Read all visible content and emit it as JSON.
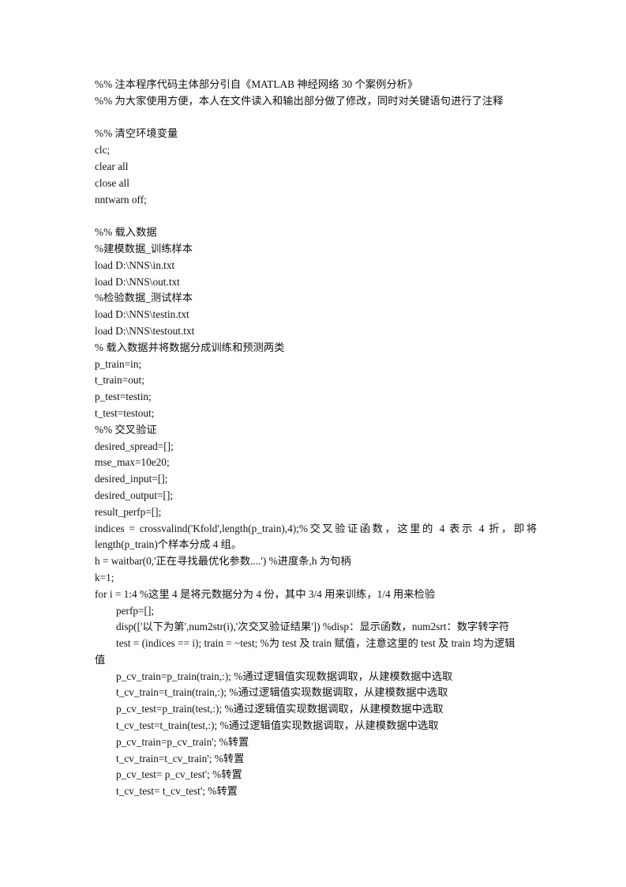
{
  "document": {
    "lines": [
      {
        "text": "%%  注本程序代码主体部分引自《MATLAB 神经网络 30 个案例分析》"
      },
      {
        "text": "%%  为大家使用方便，本人在文件读入和输出部分做了修改，同时对关键语句进行了注释"
      },
      {
        "text": ""
      },
      {
        "text": "%%  清空环境变量"
      },
      {
        "text": "clc;"
      },
      {
        "text": "clear all"
      },
      {
        "text": "close all"
      },
      {
        "text": "nntwarn off;"
      },
      {
        "text": ""
      },
      {
        "text": "%%  载入数据"
      },
      {
        "text": "%建模数据_训练样本"
      },
      {
        "text": "load D:\\NNS\\in.txt"
      },
      {
        "text": "load D:\\NNS\\out.txt"
      },
      {
        "text": "%检验数据_测试样本"
      },
      {
        "text": "load D:\\NNS\\testin.txt"
      },
      {
        "text": "load D:\\NNS\\testout.txt"
      },
      {
        "text": "%  载入数据并将数据分成训练和预测两类"
      },
      {
        "text": "p_train=in;"
      },
      {
        "text": "t_train=out;"
      },
      {
        "text": "p_test=testin;"
      },
      {
        "text": "t_test=testout;"
      },
      {
        "text": "%%  交叉验证"
      },
      {
        "text": "desired_spread=[];"
      },
      {
        "text": "mse_max=10e20;"
      },
      {
        "text": "desired_input=[];"
      },
      {
        "text": "desired_output=[];"
      },
      {
        "text": "result_perfp=[];"
      },
      {
        "text": "indices = crossvalind('Kfold',length(p_train),4);%交叉验证函数，这里的 4 表示 4 折，即将 length(p_train)个样本分成 4 组。",
        "wrap": true
      },
      {
        "text": "h = waitbar(0,'正在寻找最优化参数....') %进度条,h 为句柄"
      },
      {
        "text": "k=1;"
      },
      {
        "text": "for i = 1:4 %这里 4 是将元数据分为 4 份，其中 3/4 用来训练，1/4 用来检验"
      },
      {
        "text": "perfp=[];",
        "indent": true
      },
      {
        "text": "disp(['以下为第',num2str(i),'次交叉验证结果']) %disp：显示函数，num2srt：数字转字符",
        "indent": true
      },
      {
        "text": "test = (indices == i); train = ~test; %为 test 及 train 赋值，注意这里的 test 及 train 均为逻辑",
        "indent": true
      },
      {
        "text": "值"
      },
      {
        "text": "p_cv_train=p_train(train,:); %通过逻辑值实现数据调取，从建模数据中选取",
        "indent": true
      },
      {
        "text": "t_cv_train=t_train(train,:); %通过逻辑值实现数据调取，从建模数据中选取",
        "indent": true
      },
      {
        "text": "p_cv_test=p_train(test,:); %通过逻辑值实现数据调取，从建模数据中选取",
        "indent": true
      },
      {
        "text": "t_cv_test=t_train(test,:); %通过逻辑值实现数据调取，从建模数据中选取",
        "indent": true
      },
      {
        "text": "p_cv_train=p_cv_train'; %转置",
        "indent": true
      },
      {
        "text": "t_cv_train=t_cv_train'; %转置",
        "indent": true
      },
      {
        "text": "p_cv_test= p_cv_test'; %转置",
        "indent": true
      },
      {
        "text": "t_cv_test= t_cv_test'; %转置",
        "indent": true
      }
    ]
  }
}
